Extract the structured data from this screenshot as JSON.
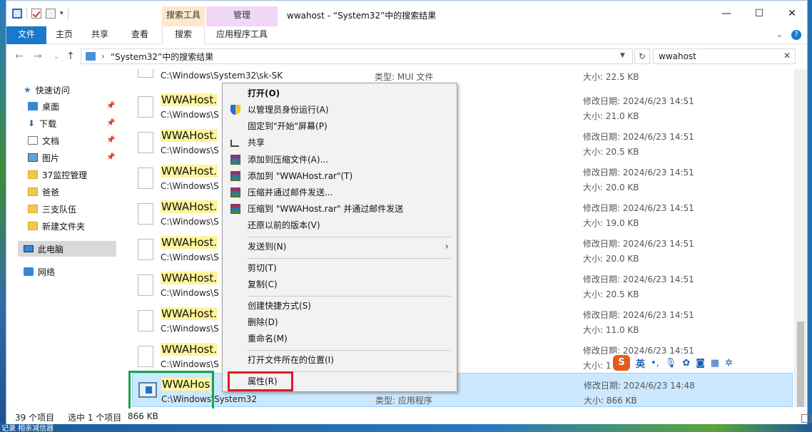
{
  "window": {
    "title": "wwahost - “System32”中的搜索结果",
    "context_tab_search_header": "搜索工具",
    "context_tab_manage_header": "管理",
    "controls": {
      "minimize": "—",
      "maximize": "☐",
      "close": "✕"
    }
  },
  "ribbon": {
    "tabs": [
      "文件",
      "主页",
      "共享",
      "查看",
      "搜索",
      "应用程序工具"
    ]
  },
  "address": {
    "path": "“System32”中的搜索结果",
    "search_value": "wwahost"
  },
  "nav": {
    "quick_access": "快速访问",
    "items": [
      "桌面",
      "下载",
      "文档",
      "图片",
      "37监控管理",
      "爸爸",
      "三支队伍",
      "新建文件夹"
    ],
    "this_pc": "此电脑",
    "network": "网络"
  },
  "files": {
    "rows": [
      {
        "name": "",
        "path": "C:\\Windows\\System32\\sk-SK",
        "type": "类型: MUI 文件",
        "date": "",
        "size": "大小: 22.5 KB"
      },
      {
        "name": "WWAHost.",
        "path": "C:\\Windows\\S",
        "type": "",
        "date": "修改日期: 2024/6/23 14:51",
        "size": "大小: 21.0 KB"
      },
      {
        "name": "WWAHost.",
        "path": "C:\\Windows\\S",
        "type": "",
        "date": "修改日期: 2024/6/23 14:51",
        "size": "大小: 20.5 KB"
      },
      {
        "name": "WWAHost.",
        "path": "C:\\Windows\\S",
        "type": "",
        "date": "修改日期: 2024/6/23 14:51",
        "size": "大小: 20.0 KB"
      },
      {
        "name": "WWAHost.",
        "path": "C:\\Windows\\S",
        "type": "",
        "date": "修改日期: 2024/6/23 14:51",
        "size": "大小: 19.0 KB"
      },
      {
        "name": "WWAHost.",
        "path": "C:\\Windows\\S",
        "type": "",
        "date": "修改日期: 2024/6/23 14:51",
        "size": "大小: 20.0 KB"
      },
      {
        "name": "WWAHost.",
        "path": "C:\\Windows\\S",
        "type": "",
        "date": "修改日期: 2024/6/23 14:51",
        "size": "大小: 20.5 KB"
      },
      {
        "name": "WWAHost.",
        "path": "C:\\Windows\\S",
        "type": "",
        "date": "修改日期: 2024/6/23 14:51",
        "size": "大小: 11.0 KB"
      },
      {
        "name": "WWAHost.",
        "path": "C:\\Windows\\S",
        "type": "",
        "date": "修改日期: 2024/6/23 14:51",
        "size": "大小: 1"
      },
      {
        "name": "WWAHos",
        "path": "C:\\Windows\\System32",
        "type": "类型: 应用程序",
        "date": "修改日期: 2024/6/23 14:48",
        "size": "大小: 866 KB"
      }
    ]
  },
  "context_menu": {
    "items": [
      "打开(O)",
      "以管理员身份运行(A)",
      "固定到\"开始\"屏幕(P)",
      "共享",
      "添加到压缩文件(A)...",
      "添加到 \"WWAHost.rar\"(T)",
      "压缩并通过邮件发送...",
      "压缩到 \"WWAHost.rar\" 并通过邮件发送",
      "还原以前的版本(V)",
      "发送到(N)",
      "剪切(T)",
      "复制(C)",
      "创建快捷方式(S)",
      "删除(D)",
      "重命名(M)",
      "打开文件所在的位置(I)",
      "属性(R)"
    ]
  },
  "status": {
    "count": "39 个项目",
    "selection": "选中 1 个项目",
    "size": "866 KB"
  },
  "ime": {
    "logo": "S",
    "lang": "英"
  },
  "desktop": {
    "taskbar_text": "记录 相亲减信器"
  }
}
